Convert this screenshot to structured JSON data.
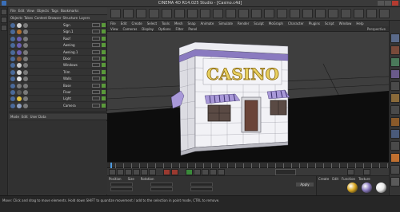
{
  "window": {
    "title": "CINEMA 4D R14.025 Studio - [Casino.c4d]"
  },
  "object_manager": {
    "menu": [
      "File",
      "Edit",
      "View",
      "Objects",
      "Tags",
      "Bookmarks"
    ],
    "tabs": [
      "Objects",
      "Takes",
      "Content Browser",
      "Structure",
      "Layers"
    ],
    "rows": [
      {
        "label": "Sign",
        "tag_color": "#cfcfcf"
      },
      {
        "label": "Sign.1",
        "tag_color": "#b07030"
      },
      {
        "label": "Roof",
        "tag_color": "#6b5fb0"
      },
      {
        "label": "Awning",
        "tag_color": "#6b5fb0"
      },
      {
        "label": "Awning.1",
        "tag_color": "#6b5fb0"
      },
      {
        "label": "Door",
        "tag_color": "#8a5a3a"
      },
      {
        "label": "Windows",
        "tag_color": "#c9c9c9"
      },
      {
        "label": "Trim",
        "tag_color": "#d0d0d0"
      },
      {
        "label": "Walls",
        "tag_color": "#e4e4e4"
      },
      {
        "label": "Base",
        "tag_color": "#7c7c7c"
      },
      {
        "label": "Floor",
        "tag_color": "#5a5a5a"
      },
      {
        "label": "Light",
        "tag_color": "#e0c040"
      },
      {
        "label": "Camera",
        "tag_color": "#8fa0c0"
      }
    ]
  },
  "attribute_manager": {
    "tabs": [
      "Mode",
      "Edit",
      "User Data"
    ]
  },
  "menubar": {
    "items": [
      "File",
      "Edit",
      "Create",
      "Select",
      "Tools",
      "Mesh",
      "Snap",
      "Animate",
      "Simulate",
      "Render",
      "Sculpt",
      "MoGraph",
      "Character",
      "Plugins",
      "Script",
      "Window",
      "Help"
    ]
  },
  "viewport": {
    "menu": [
      "View",
      "Cameras",
      "Display",
      "Options",
      "Filter",
      "Panel"
    ],
    "label": "Perspective",
    "sign_text": "CASINO"
  },
  "coordinates": {
    "headers": [
      "Position",
      "Size",
      "Rotation"
    ],
    "apply_label": "Apply"
  },
  "material_manager": {
    "menu": [
      "Create",
      "Edit",
      "Function",
      "Texture"
    ],
    "materials": [
      {
        "color": "#d8a620"
      },
      {
        "color": "#8a7ac0"
      },
      {
        "color": "#e8e8e8"
      }
    ]
  },
  "status": {
    "message": "Move: Click and drag to move elements. Hold down SHIFT to quantize movement / add to the selection in point mode, CTRL to remove."
  }
}
